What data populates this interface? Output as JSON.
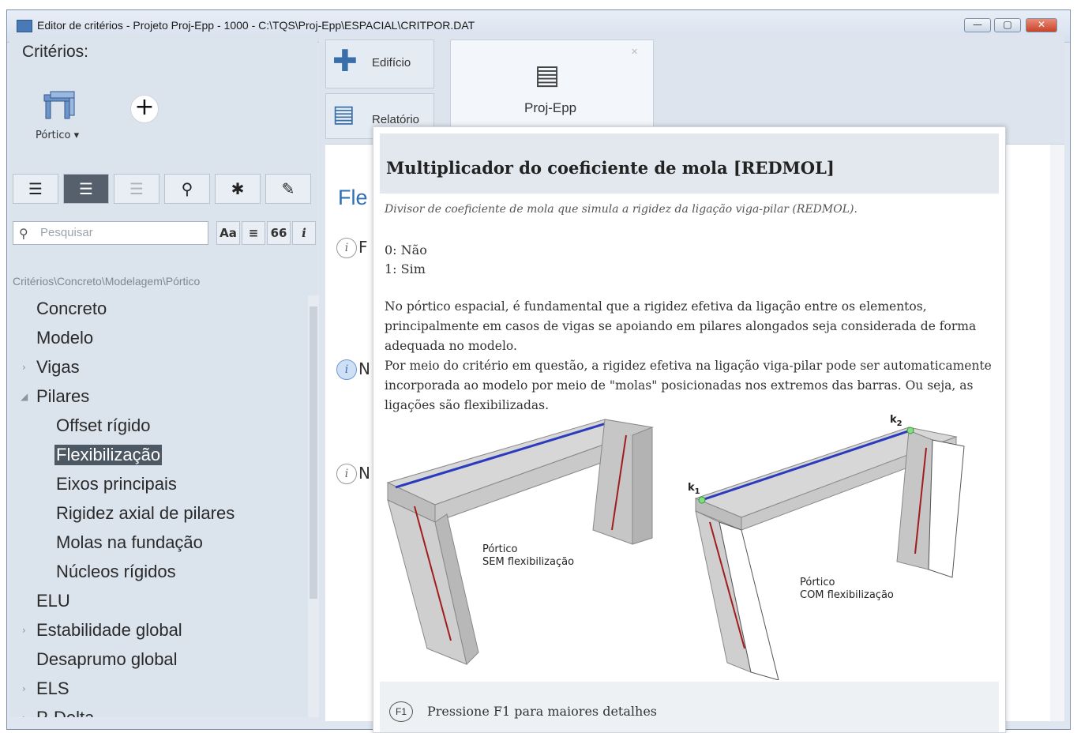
{
  "window": {
    "title": "Editor de critérios - Projeto Proj-Epp - 1000 - C:\\TQS\\Proj-Epp\\ESPACIAL\\CRITPOR.DAT",
    "min_label": "—",
    "max_label": "▢",
    "close_label": "✕"
  },
  "left_panel": {
    "title": "Critérios:",
    "portico_label": "Pórtico ▾",
    "add_label": "+",
    "toolbar_icons": [
      "list-icon",
      "list-expanded-icon",
      "list-disabled-icon",
      "wrench-icon",
      "asterisk-icon",
      "pencil-icon"
    ],
    "search": {
      "placeholder": "Pesquisar"
    },
    "search_buttons": [
      "Aa",
      "≡",
      "66",
      "i"
    ],
    "breadcrumb": "Critérios\\Concreto\\Modelagem\\Pórtico",
    "tree": [
      {
        "label": "Concreto",
        "level": 0,
        "arrow": ""
      },
      {
        "label": "Modelo",
        "level": 0,
        "arrow": ""
      },
      {
        "label": "Vigas",
        "level": 0,
        "arrow": "›"
      },
      {
        "label": "Pilares",
        "level": 0,
        "arrow": "◢"
      },
      {
        "label": "Offset rígido",
        "level": 1,
        "arrow": ""
      },
      {
        "label": "Flexibilização",
        "level": 1,
        "arrow": "",
        "selected": true
      },
      {
        "label": "Eixos principais",
        "level": 1,
        "arrow": ""
      },
      {
        "label": "Rigidez axial de pilares",
        "level": 1,
        "arrow": ""
      },
      {
        "label": "Molas na fundação",
        "level": 1,
        "arrow": ""
      },
      {
        "label": "Núcleos rígidos",
        "level": 1,
        "arrow": ""
      },
      {
        "label": "ELU",
        "level": 0,
        "arrow": ""
      },
      {
        "label": "Estabilidade global",
        "level": 0,
        "arrow": "›"
      },
      {
        "label": "Desaprumo global",
        "level": 0,
        "arrow": ""
      },
      {
        "label": "ELS",
        "level": 0,
        "arrow": "›"
      },
      {
        "label": "P-Delta",
        "level": 0,
        "arrow": "›"
      }
    ]
  },
  "ribbon": {
    "edificio": "Edifício",
    "relatorio": "Relatório",
    "project": "Proj-Epp"
  },
  "content": {
    "heading_partial": "Fle",
    "info_letters": [
      "F",
      "N",
      "N"
    ]
  },
  "tooltip": {
    "title": "Multiplicador do coeficiente de mola [REDMOL]",
    "subtitle": "Divisor de coeficiente de mola que simula a rigidez da ligação viga-pilar (REDMOL).",
    "option0": "0: Não",
    "option1": "1: Sim",
    "para1": "No pórtico espacial, é fundamental que a rigidez efetiva da ligação entre os elementos, principalmente em casos de vigas se apoiando em pilares alongados seja considerada de forma adequada no modelo.",
    "para2": "Por meio do critério em questão, a rigidez efetiva na ligação viga-pilar pode ser automaticamente incorporada ao modelo por meio de \"molas\" posicionadas nos extremos das barras. Ou seja, as ligações são flexibilizadas.",
    "fig_left_line1": "Pórtico",
    "fig_left_line2": "SEM flexibilização",
    "fig_right_line1": "Pórtico",
    "fig_right_line2": "COM flexibilização",
    "k1": "k",
    "k1_sub": "1",
    "k2": "k",
    "k2_sub": "2",
    "f1_key": "F1",
    "footer": "Pressione F1 para maiores detalhes"
  }
}
